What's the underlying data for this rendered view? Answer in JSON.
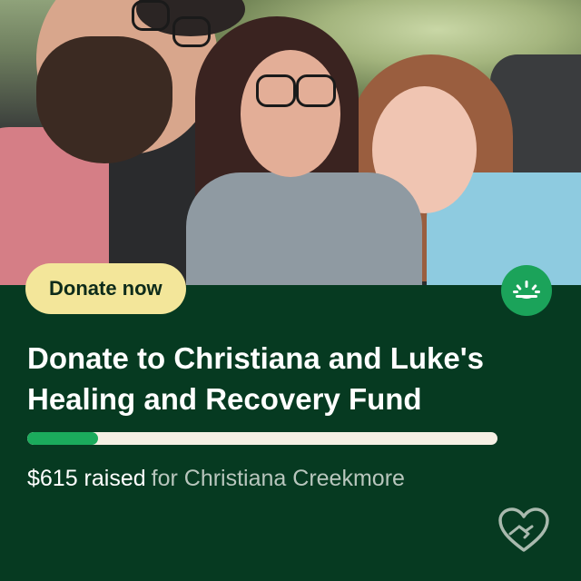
{
  "photo": {
    "alt": "Family selfie in a car"
  },
  "donate_button": {
    "label": "Donate now"
  },
  "logo": {
    "icon": "gofundme-logo-icon",
    "color": "#1ba35a"
  },
  "campaign": {
    "title": "Donate to Christiana and Luke's Healing and Recovery Fund",
    "progress_fraction": 0.15,
    "raised_amount": "$615 raised",
    "for_text": "for Christiana Creekmore"
  },
  "footer": {
    "icon": "heart-hands-icon"
  },
  "colors": {
    "panel_background": "#063a21",
    "button_background": "#f3e69a",
    "progress_fill": "#1bab5c",
    "progress_track": "#f5f0e4"
  }
}
